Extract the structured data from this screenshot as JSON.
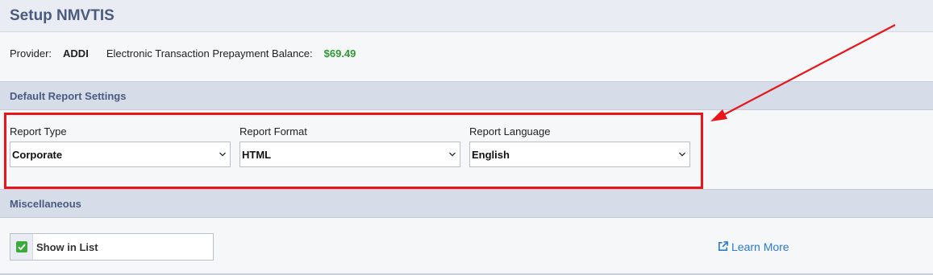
{
  "header": {
    "title": "Setup NMVTIS"
  },
  "provider": {
    "provider_label": "Provider:",
    "provider_value": "ADDI",
    "balance_label": "Electronic Transaction Prepayment Balance:",
    "balance_value": "$69.49",
    "balance_color": "#2e9a2e"
  },
  "default_report_settings": {
    "title": "Default Report Settings",
    "report_type": {
      "label": "Report Type",
      "value": "Corporate"
    },
    "report_format": {
      "label": "Report Format",
      "value": "HTML"
    },
    "report_language": {
      "label": "Report Language",
      "value": "English"
    }
  },
  "miscellaneous": {
    "title": "Miscellaneous",
    "show_in_list": {
      "label": "Show in List",
      "checked": true
    },
    "learn_more": {
      "label": "Learn More",
      "icon": "external-link-icon"
    }
  },
  "annotation": {
    "highlight_color": "#e8151b"
  }
}
